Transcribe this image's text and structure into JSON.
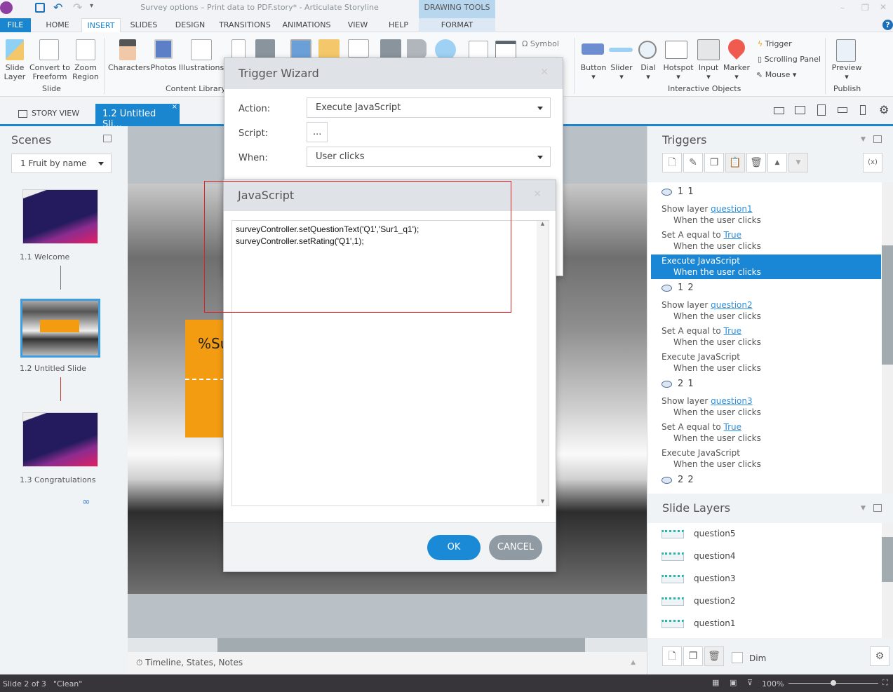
{
  "window": {
    "title": "Survey options – Print data to PDF.story* -  Articulate Storyline",
    "contextual_tab_group": "DRAWING TOOLS"
  },
  "tabs": [
    "FILE",
    "HOME",
    "INSERT",
    "SLIDES",
    "DESIGN",
    "TRANSITIONS",
    "ANIMATIONS",
    "VIEW",
    "HELP",
    "FORMAT"
  ],
  "active_tab": "INSERT",
  "ribbon": {
    "slide_group": {
      "label": "Slide",
      "items": [
        "Slide\nLayer",
        "Convert to\nFreeform",
        "Zoom\nRegion"
      ]
    },
    "content_library": {
      "label": "Content Library",
      "items": [
        "Characters",
        "Photos",
        "Illustrations"
      ]
    },
    "symbol": "Symbol",
    "interactive_objects": {
      "label": "Interactive Objects",
      "items": [
        "Button",
        "Slider",
        "Dial",
        "Hotspot",
        "Input",
        "Marker"
      ],
      "trigger": "Trigger",
      "scrolling_panel": "Scrolling Panel",
      "mouse": "Mouse"
    },
    "publish": {
      "label": "Publish",
      "preview": "Preview"
    }
  },
  "viewbar": {
    "story_view": "STORY VIEW",
    "slide_tab": "1.2 Untitled Sli..."
  },
  "scenes": {
    "title": "Scenes",
    "scene_select": "1 Fruit by name",
    "slides": [
      "1.1 Welcome",
      "1.2 Untitled Slide",
      "1.3 Congratulations"
    ],
    "selected_slide": "1.2 Untitled Slide"
  },
  "canvas": {
    "text_fragment": "%Su"
  },
  "timeline_bar": "Timeline, States, Notes",
  "trigger_wizard": {
    "title": "Trigger Wizard",
    "action_label": "Action:",
    "action_value": "Execute JavaScript",
    "script_label": "Script:",
    "script_button": "...",
    "when_label": "When:",
    "when_value": "User clicks"
  },
  "javascript_dialog": {
    "title": "JavaScript",
    "code": "surveyController.setQuestionText('Q1','Sur1_q1');\nsurveyController.setRating('Q1',1);",
    "ok": "OK",
    "cancel": "CANCEL",
    "accent": "#1a8ad6"
  },
  "triggers_panel": {
    "title": "Triggers",
    "groups": [
      {
        "object": "1 1",
        "items": [
          {
            "action": "Show layer ",
            "link": "question1",
            "when": "When the user clicks"
          },
          {
            "action": "Set A equal to ",
            "link": "True",
            "when": "When the user clicks"
          },
          {
            "action": "Execute JavaScript",
            "link": "",
            "when": "When the user clicks",
            "selected": true
          }
        ]
      },
      {
        "object": "1 2",
        "items": [
          {
            "action": "Show layer ",
            "link": "question2",
            "when": "When the user clicks"
          },
          {
            "action": "Set A equal to ",
            "link": "True",
            "when": "When the user clicks"
          },
          {
            "action": "Execute JavaScript",
            "link": "",
            "when": "When the user clicks"
          }
        ]
      },
      {
        "object": "2 1",
        "items": [
          {
            "action": "Show layer ",
            "link": "question3",
            "when": "When the user clicks"
          },
          {
            "action": "Set A equal to ",
            "link": "True",
            "when": "When the user clicks"
          },
          {
            "action": "Execute JavaScript",
            "link": "",
            "when": "When the user clicks"
          }
        ]
      },
      {
        "object": "2 2",
        "items": []
      }
    ]
  },
  "slide_layers": {
    "title": "Slide Layers",
    "layers": [
      "question5",
      "question4",
      "question3",
      "question2",
      "question1"
    ],
    "dim_label": "Dim"
  },
  "status": {
    "slide": "Slide 2 of 3",
    "theme": "\"Clean\"",
    "zoom": "100%"
  }
}
